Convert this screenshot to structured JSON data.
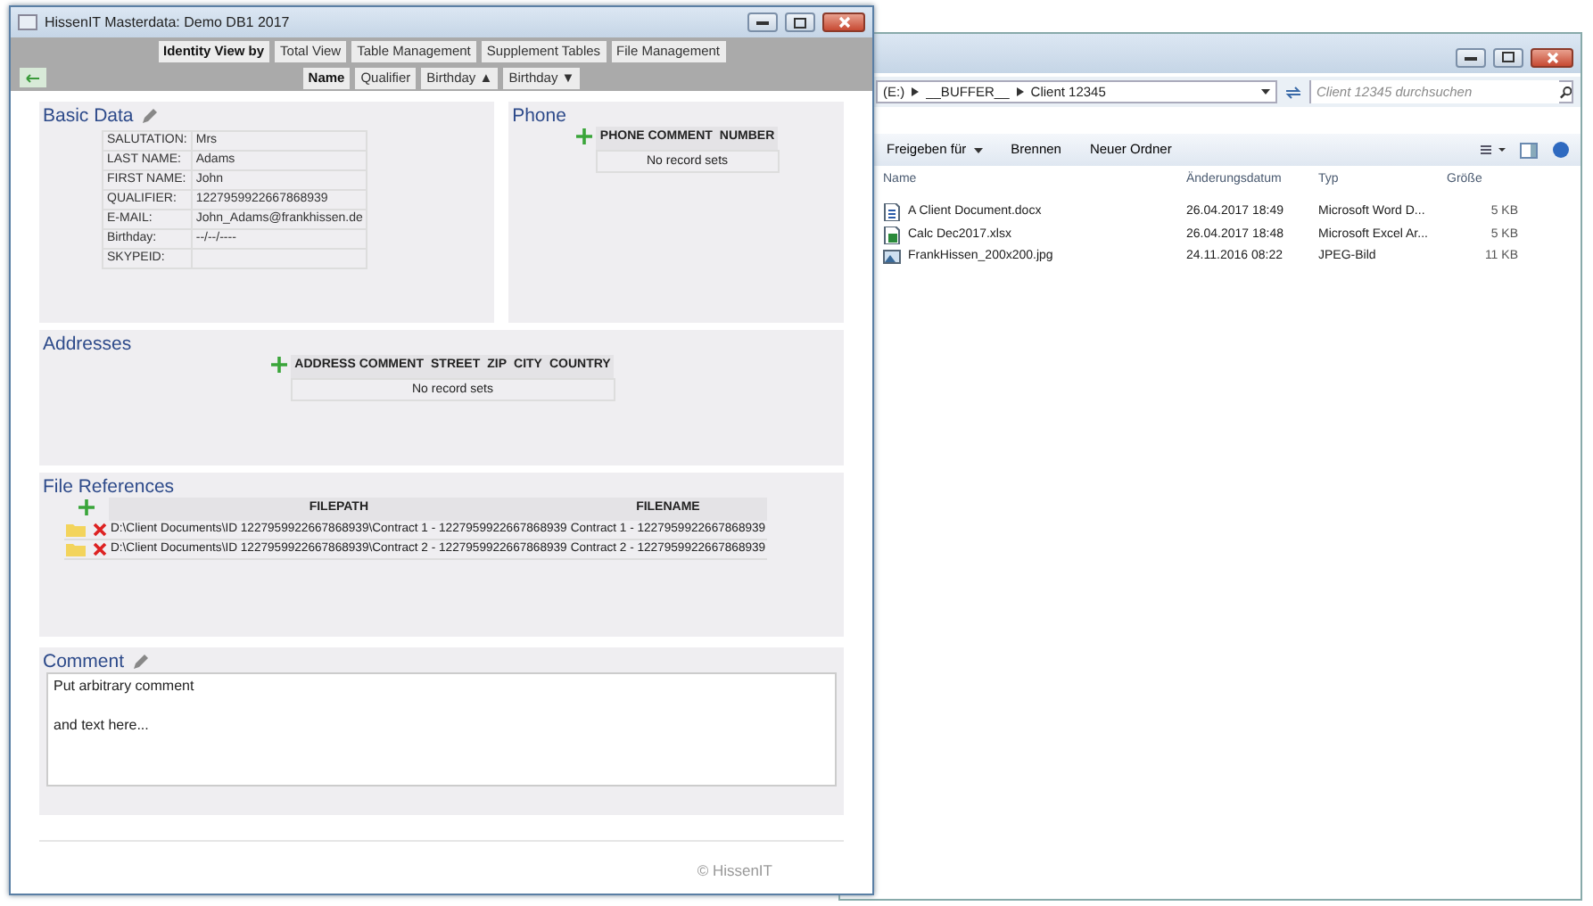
{
  "app_window": {
    "title": "HissenIT Masterdata: Demo DB1 2017",
    "nav_tabs": [
      {
        "label": "Identity View by",
        "selected": true
      },
      {
        "label": "Total View",
        "selected": false
      },
      {
        "label": "Table Management",
        "selected": false
      },
      {
        "label": "Supplement Tables",
        "selected": false
      },
      {
        "label": "File Management",
        "selected": false
      }
    ],
    "sort_buttons": [
      {
        "label": "Name",
        "selected": true
      },
      {
        "label": "Qualifier",
        "selected": false
      },
      {
        "label": "Birthday ▲",
        "selected": false
      },
      {
        "label": "Birthday ▼",
        "selected": false
      }
    ],
    "basic_data": {
      "title": "Basic Data",
      "fields": [
        {
          "label": "SALUTATION:",
          "value": "Mrs"
        },
        {
          "label": "LAST NAME:",
          "value": "Adams"
        },
        {
          "label": "FIRST NAME:",
          "value": "John"
        },
        {
          "label": "QUALIFIER:",
          "value": "1227959922667868939"
        },
        {
          "label": "E-MAIL:",
          "value": "John_Adams@frankhissen.de"
        },
        {
          "label": "Birthday:",
          "value": "--/--/----"
        },
        {
          "label": "SKYPEID:"
        }
      ]
    },
    "phone": {
      "title": "Phone",
      "columns": [
        "PHONE COMMENT",
        "NUMBER"
      ],
      "empty_text": "No record sets"
    },
    "addresses": {
      "title": "Addresses",
      "columns": [
        "ADDRESS COMMENT",
        "STREET",
        "ZIP",
        "CITY",
        "COUNTRY"
      ],
      "empty_text": "No record sets"
    },
    "file_references": {
      "title": "File References",
      "columns": [
        "FILEPATH",
        "FILENAME"
      ],
      "rows": [
        {
          "filepath": "D:\\Client Documents\\ID 1227959922667868939\\Contract 1 - 1227959922667868939",
          "filename": "Contract 1 - 1227959922667868939"
        },
        {
          "filepath": "D:\\Client Documents\\ID 1227959922667868939\\Contract 2 - 1227959922667868939",
          "filename": "Contract 2 - 1227959922667868939"
        }
      ]
    },
    "comment": {
      "title": "Comment",
      "lines": [
        "Put arbitrary comment",
        "and text here..."
      ]
    },
    "footer": "© HissenIT"
  },
  "explorer_window": {
    "breadcrumb": [
      "(E:)",
      "__BUFFER__",
      "Client 12345"
    ],
    "search": {
      "placeholder": "Client 12345 durchsuchen"
    },
    "toolbar": [
      {
        "label": "Freigeben für",
        "kind": "menu"
      },
      {
        "label": "Brennen",
        "kind": "plain"
      },
      {
        "label": "Neuer Ordner",
        "kind": "plain"
      }
    ],
    "columns": [
      "Name",
      "Änderungsdatum",
      "Typ",
      "Größe"
    ],
    "files": [
      {
        "name": "A Client Document.docx",
        "date": "26.04.2017 18:49",
        "type": "Microsoft Word D...",
        "size": "5 KB",
        "kind": "word"
      },
      {
        "name": "Calc Dec2017.xlsx",
        "date": "26.04.2017 18:48",
        "type": "Microsoft Excel Ar...",
        "size": "5 KB",
        "kind": "excel"
      },
      {
        "name": "FrankHissen_200x200.jpg",
        "date": "24.11.2016 08:22",
        "type": "JPEG-Bild",
        "size": "11 KB",
        "kind": "image"
      }
    ]
  }
}
